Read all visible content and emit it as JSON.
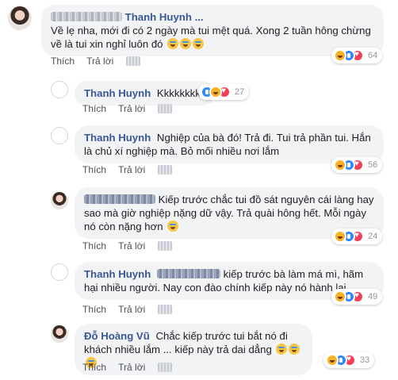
{
  "comments": [
    {
      "name": "Thanh Huynh ...",
      "text": "Về lẹ nha, mới đi có 2 ngày mà tui mệt quá. Xong 2 tuần hông chừng về là tui xin nghỉ luôn đó",
      "like_label": "Thích",
      "reply_label": "Trả lời",
      "reaction_count": "64"
    },
    {
      "name": "Thanh Huynh",
      "text": "Kkkkkkkkk",
      "like_label": "Thích",
      "reply_label": "Trả lời",
      "reaction_count": "27"
    },
    {
      "name": "Thanh Huynh",
      "text": "Nghiệp của bà đó! Trả đi. Tui trả phần tui. Hắn là chủ xí nghiệp mà. Bỏ mối nhiều nơi lắm",
      "like_label": "Thích",
      "reply_label": "Trả lời",
      "reaction_count": "56"
    },
    {
      "name": "Đỗ Hoàng Vũ",
      "text": "Kiếp trước chắc tui đồ sát nguyên cái làng hay sao mà giờ nghiệp nặng dữ vậy. Trả quài hông hết. Mỗi ngày nó còn nặng hơn",
      "like_label": "Thích",
      "reply_label": "Trả lời",
      "reaction_count": "24"
    },
    {
      "name": "Thanh Huynh",
      "text": "kiếp trước bà làm má mì, hãm hại nhiều người. Nay con đào chính kiếp này nó hành lại",
      "like_label": "Thích",
      "reply_label": "Trả lời",
      "reaction_count": "49"
    },
    {
      "name": "Đỗ Hoàng Vũ",
      "text": "Chắc kiếp trước tui bắt nó đi khách nhiều lắm ... kiếp này trả dai dẳng",
      "like_label": "Thích",
      "reply_label": "Trả lời",
      "reaction_count": "33"
    }
  ]
}
